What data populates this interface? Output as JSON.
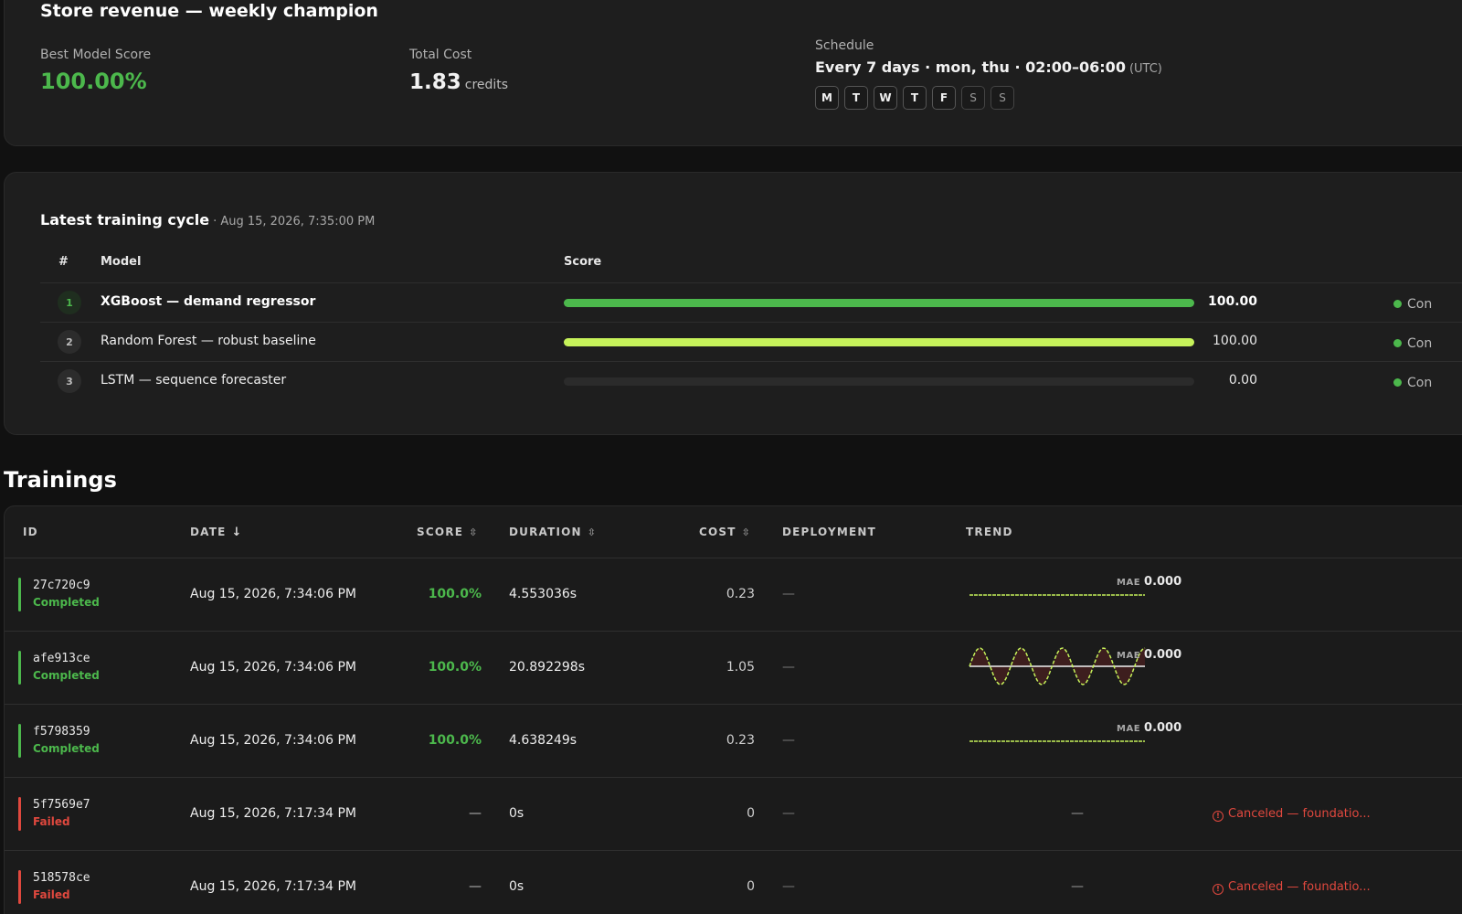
{
  "summary": {
    "title": "Store revenue — weekly champion",
    "best_label": "Best Model Score",
    "best_value": "100.00%",
    "cost_label": "Total Cost",
    "cost_value": "1.83",
    "cost_unit": "credits",
    "schedule_label": "Schedule",
    "schedule_value": "Every 7 days · mon, thu · 02:00–06:00",
    "schedule_tz": "(UTC)",
    "days": [
      {
        "label": "M",
        "active": true
      },
      {
        "label": "T",
        "active": true
      },
      {
        "label": "W",
        "active": true
      },
      {
        "label": "T",
        "active": true
      },
      {
        "label": "F",
        "active": true
      },
      {
        "label": "S",
        "active": false
      },
      {
        "label": "S",
        "active": false
      }
    ]
  },
  "cycle": {
    "title": "Latest training cycle",
    "date": "· Aug 15, 2026, 7:35:00 PM",
    "headers": {
      "rank": "#",
      "model": "Model",
      "score": "Score"
    },
    "rows": [
      {
        "rank": "1",
        "model": "XGBoost — demand regressor",
        "score": "100.00",
        "score_fraction": 1.0,
        "bar_color": "#4cb84c",
        "status": "Con"
      },
      {
        "rank": "2",
        "model": "Random Forest — robust baseline",
        "score": "100.00",
        "score_fraction": 1.0,
        "bar_color": "#c6f25a",
        "status": "Con"
      },
      {
        "rank": "3",
        "model": "LSTM — sequence forecaster",
        "score": "0.00",
        "score_fraction": 0.0,
        "bar_color": "#c6f25a",
        "status": "Con"
      }
    ]
  },
  "trainings": {
    "title": "Trainings",
    "columns": {
      "id": "ID",
      "date": "DATE",
      "score": "SCORE",
      "duration": "DURATION",
      "cost": "COST",
      "deployment": "DEPLOYMENT",
      "trend": "TREND"
    },
    "rows": [
      {
        "id": "27c720c9",
        "status": "Completed",
        "status_color": "#4cb84c",
        "date": "Aug 15, 2026, 7:34:06 PM",
        "score": "100.0%",
        "duration": "4.553036s",
        "cost": "0.23",
        "deployment": "—",
        "trend": {
          "kind": "flat",
          "mae_label": "MAE",
          "mae_value": "0.000"
        }
      },
      {
        "id": "afe913ce",
        "status": "Completed",
        "status_color": "#4cb84c",
        "date": "Aug 15, 2026, 7:34:06 PM",
        "score": "100.0%",
        "duration": "20.892298s",
        "cost": "1.05",
        "deployment": "—",
        "trend": {
          "kind": "wave",
          "mae_label": "MAE",
          "mae_value": "0.000"
        }
      },
      {
        "id": "f5798359",
        "status": "Completed",
        "status_color": "#4cb84c",
        "date": "Aug 15, 2026, 7:34:06 PM",
        "score": "100.0%",
        "duration": "4.638249s",
        "cost": "0.23",
        "deployment": "—",
        "trend": {
          "kind": "flat",
          "mae_label": "MAE",
          "mae_value": "0.000"
        }
      },
      {
        "id": "5f7569e7",
        "status": "Failed",
        "status_color": "#e0483e",
        "date": "Aug 15, 2026, 7:17:34 PM",
        "score": "—",
        "duration": "0s",
        "cost": "0",
        "deployment": "—",
        "trend": {
          "kind": "none",
          "placeholder": "—"
        },
        "error": "Canceled — foundatio..."
      },
      {
        "id": "518578ce",
        "status": "Failed",
        "status_color": "#e0483e",
        "date": "Aug 15, 2026, 7:17:34 PM",
        "score": "—",
        "duration": "0s",
        "cost": "0",
        "deployment": "—",
        "trend": {
          "kind": "none",
          "placeholder": "—"
        },
        "error": "Canceled — foundatio..."
      }
    ]
  }
}
